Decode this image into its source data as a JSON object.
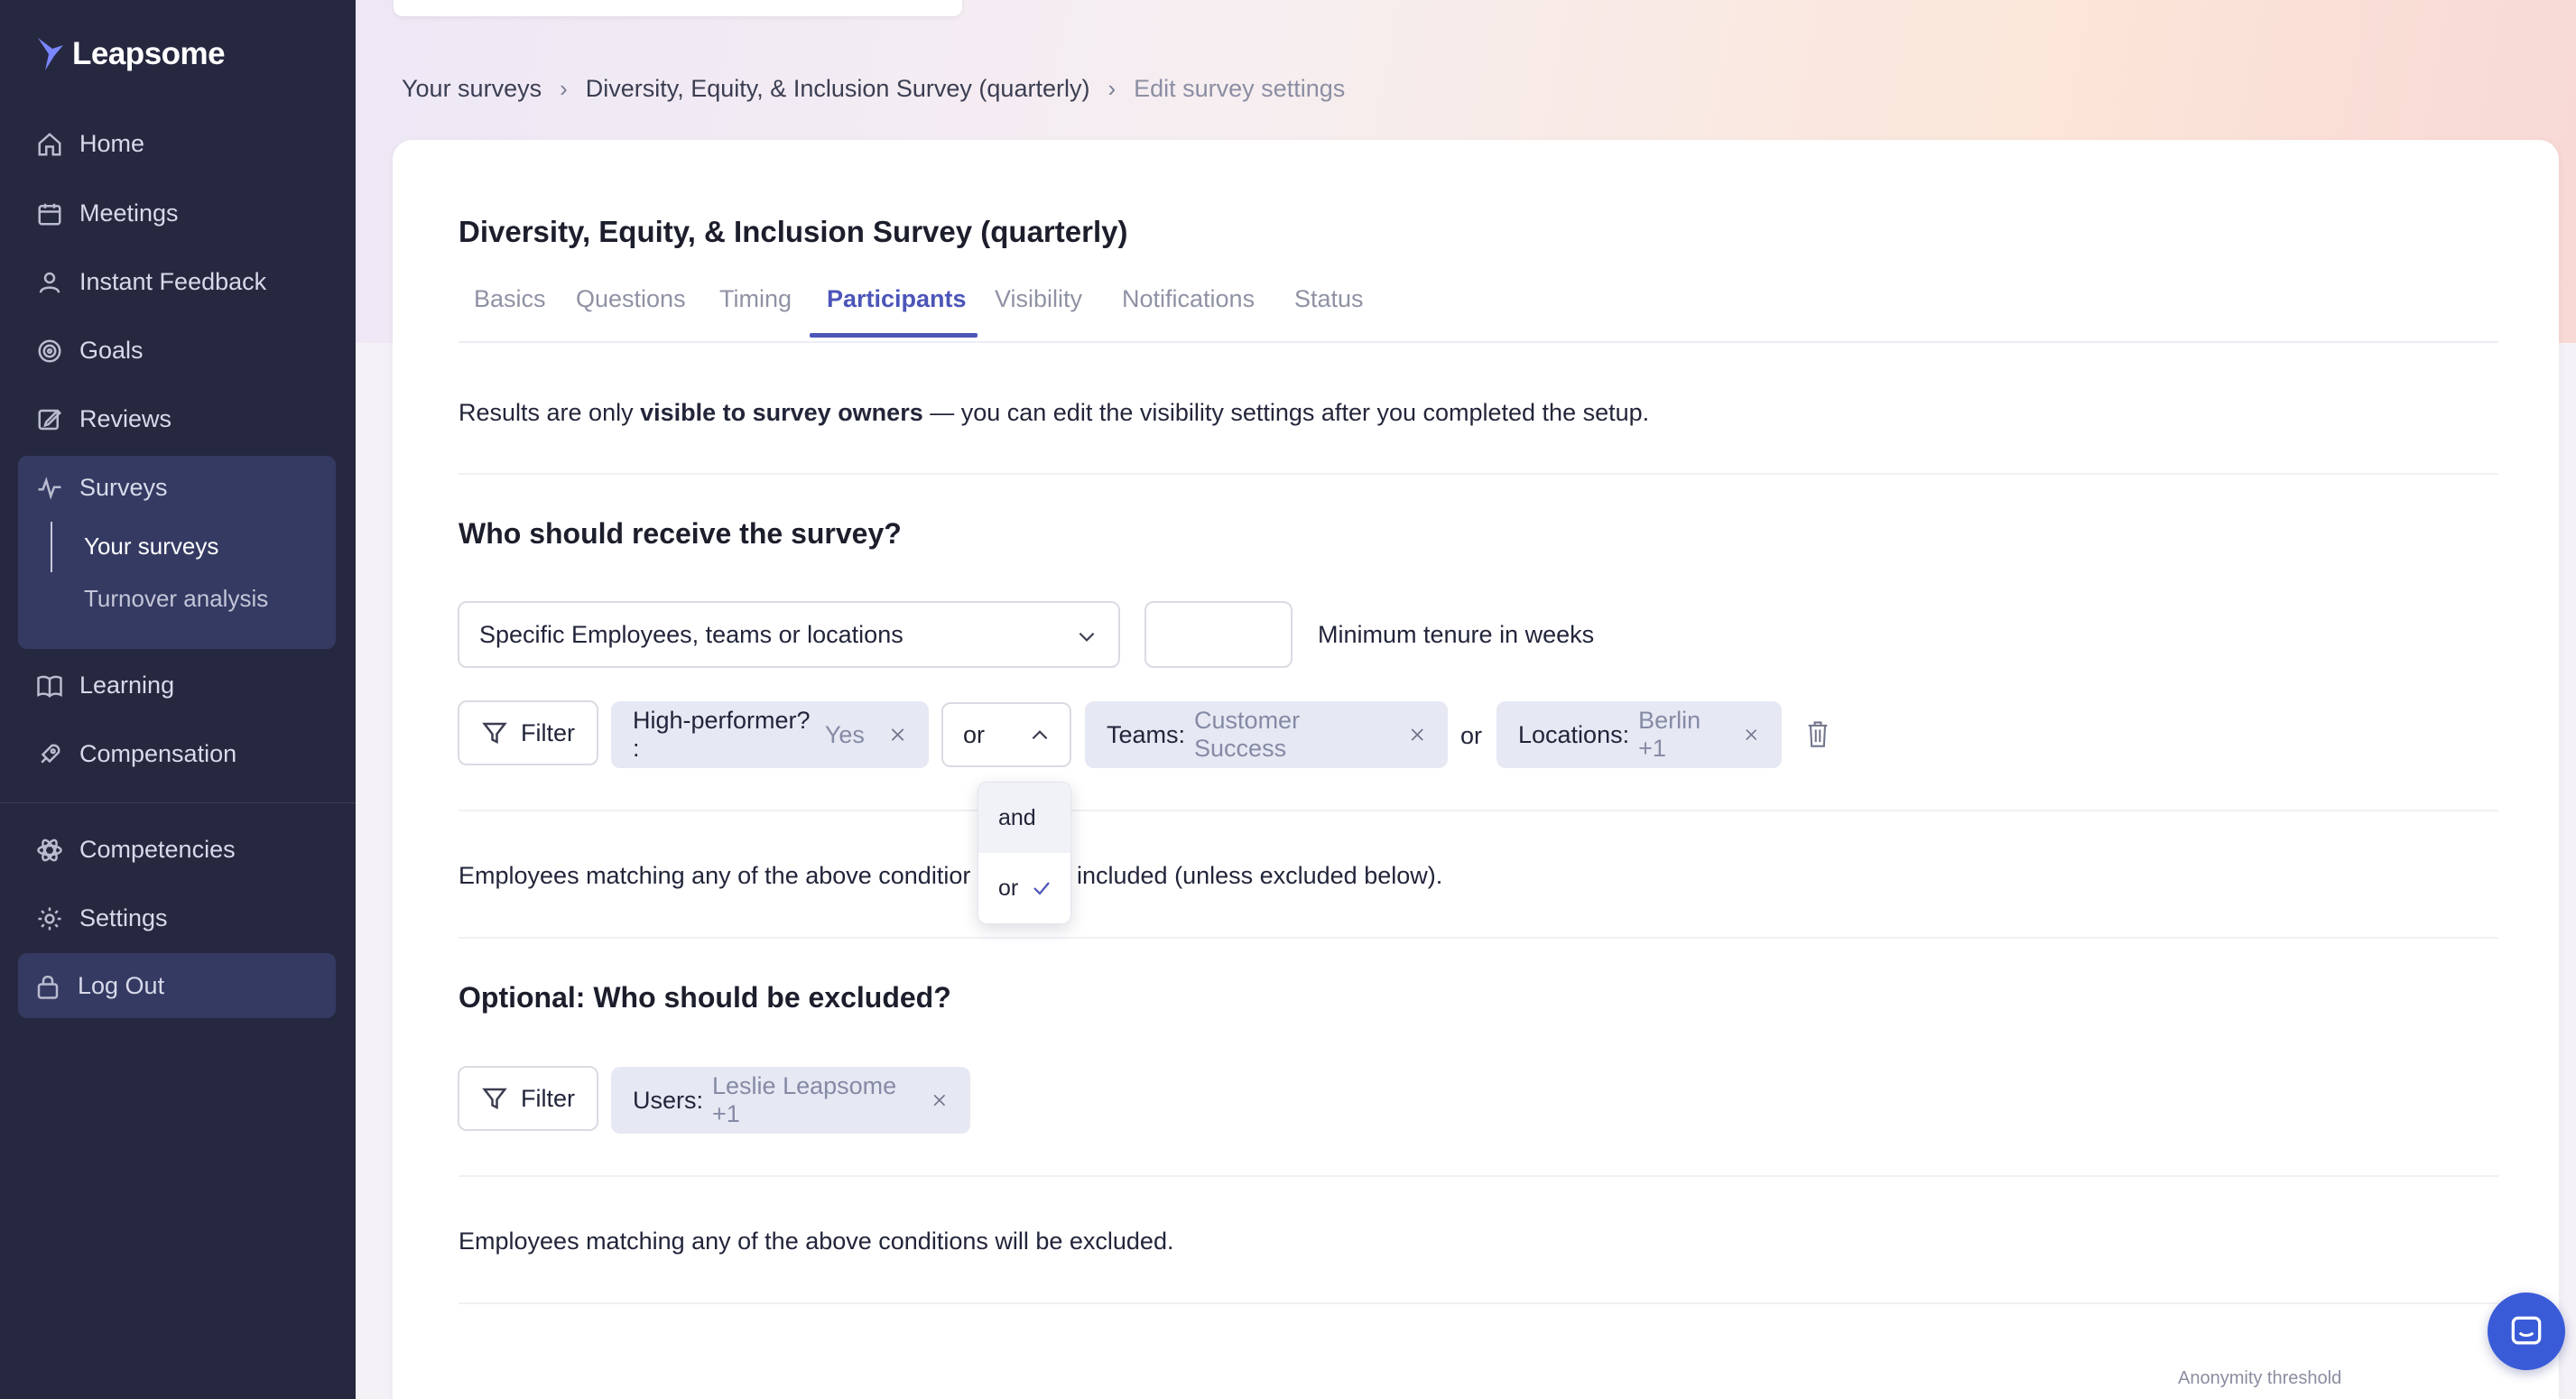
{
  "app": {
    "name": "Leapsome"
  },
  "sidebar": {
    "items": [
      {
        "label": "Home",
        "icon": "home-icon"
      },
      {
        "label": "Meetings",
        "icon": "calendar-icon"
      },
      {
        "label": "Instant Feedback",
        "icon": "feedback-icon"
      },
      {
        "label": "Goals",
        "icon": "target-icon"
      },
      {
        "label": "Reviews",
        "icon": "edit-icon"
      },
      {
        "label": "Surveys",
        "icon": "pulse-icon",
        "active": true
      },
      {
        "label": "Learning",
        "icon": "book-icon"
      },
      {
        "label": "Compensation",
        "icon": "rocket-icon"
      },
      {
        "label": "Competencies",
        "icon": "atom-icon"
      },
      {
        "label": "Settings",
        "icon": "gear-icon"
      }
    ],
    "surveys_sub": [
      {
        "label": "Your surveys",
        "active": true
      },
      {
        "label": "Turnover analysis"
      }
    ],
    "logout": {
      "label": "Log Out",
      "icon": "lock-icon"
    }
  },
  "breadcrumb": [
    "Your surveys",
    "Diversity, Equity, & Inclusion Survey (quarterly)",
    "Edit survey settings"
  ],
  "page": {
    "title": "Diversity, Equity, & Inclusion Survey (quarterly)",
    "tabs": [
      "Basics",
      "Questions",
      "Timing",
      "Participants",
      "Visibility",
      "Notifications",
      "Status"
    ],
    "active_tab": "Participants",
    "info": {
      "prefix": "Results are only ",
      "bold": "visible to survey owners",
      "suffix": " — you can edit the visibility settings after you completed the setup."
    }
  },
  "receive": {
    "title": "Who should receive the survey?",
    "select_value": "Specific Employees, teams or locations",
    "tenure_value": "",
    "tenure_label": "Minimum tenure in weeks",
    "filter_label": "Filter",
    "chips": [
      {
        "key": "High-performer? :",
        "value": "Yes"
      },
      {
        "key": "Teams:",
        "value": "Customer Success"
      },
      {
        "key": "Locations:",
        "value": "Berlin +1"
      }
    ],
    "operator": "or",
    "connector": "or",
    "dropdown_options": [
      {
        "label": "and",
        "selected": false
      },
      {
        "label": "or",
        "selected": true
      }
    ],
    "note_left": "Employees matching any of the above conditior",
    "note_right": "included (unless excluded below)."
  },
  "exclude": {
    "title": "Optional: Who should be excluded?",
    "filter_label": "Filter",
    "chips": [
      {
        "key": "Users:",
        "value": "Leslie Leapsome +1"
      }
    ],
    "note": "Employees matching any of the above conditions will be excluded."
  },
  "footer": {
    "anonymity_label": "Anonymity threshold"
  },
  "colors": {
    "sidebar_bg": "#262840",
    "accent": "#4c55b8",
    "chip_bg": "#e6e8f3",
    "chat_button": "#3a5bd8"
  }
}
